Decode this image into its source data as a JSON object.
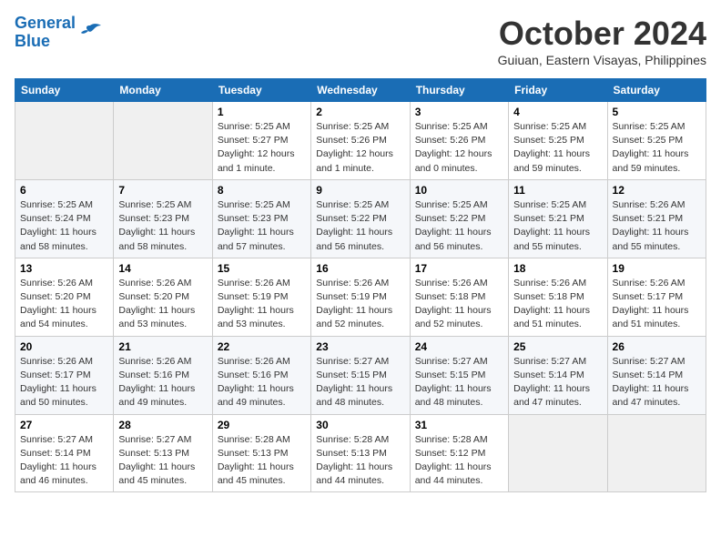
{
  "header": {
    "logo_line1": "General",
    "logo_line2": "Blue",
    "month": "October 2024",
    "location": "Guiuan, Eastern Visayas, Philippines"
  },
  "weekdays": [
    "Sunday",
    "Monday",
    "Tuesday",
    "Wednesday",
    "Thursday",
    "Friday",
    "Saturday"
  ],
  "weeks": [
    [
      {
        "day": "",
        "info": ""
      },
      {
        "day": "",
        "info": ""
      },
      {
        "day": "1",
        "info": "Sunrise: 5:25 AM\nSunset: 5:27 PM\nDaylight: 12 hours\nand 1 minute."
      },
      {
        "day": "2",
        "info": "Sunrise: 5:25 AM\nSunset: 5:26 PM\nDaylight: 12 hours\nand 1 minute."
      },
      {
        "day": "3",
        "info": "Sunrise: 5:25 AM\nSunset: 5:26 PM\nDaylight: 12 hours\nand 0 minutes."
      },
      {
        "day": "4",
        "info": "Sunrise: 5:25 AM\nSunset: 5:25 PM\nDaylight: 11 hours\nand 59 minutes."
      },
      {
        "day": "5",
        "info": "Sunrise: 5:25 AM\nSunset: 5:25 PM\nDaylight: 11 hours\nand 59 minutes."
      }
    ],
    [
      {
        "day": "6",
        "info": "Sunrise: 5:25 AM\nSunset: 5:24 PM\nDaylight: 11 hours\nand 58 minutes."
      },
      {
        "day": "7",
        "info": "Sunrise: 5:25 AM\nSunset: 5:23 PM\nDaylight: 11 hours\nand 58 minutes."
      },
      {
        "day": "8",
        "info": "Sunrise: 5:25 AM\nSunset: 5:23 PM\nDaylight: 11 hours\nand 57 minutes."
      },
      {
        "day": "9",
        "info": "Sunrise: 5:25 AM\nSunset: 5:22 PM\nDaylight: 11 hours\nand 56 minutes."
      },
      {
        "day": "10",
        "info": "Sunrise: 5:25 AM\nSunset: 5:22 PM\nDaylight: 11 hours\nand 56 minutes."
      },
      {
        "day": "11",
        "info": "Sunrise: 5:25 AM\nSunset: 5:21 PM\nDaylight: 11 hours\nand 55 minutes."
      },
      {
        "day": "12",
        "info": "Sunrise: 5:26 AM\nSunset: 5:21 PM\nDaylight: 11 hours\nand 55 minutes."
      }
    ],
    [
      {
        "day": "13",
        "info": "Sunrise: 5:26 AM\nSunset: 5:20 PM\nDaylight: 11 hours\nand 54 minutes."
      },
      {
        "day": "14",
        "info": "Sunrise: 5:26 AM\nSunset: 5:20 PM\nDaylight: 11 hours\nand 53 minutes."
      },
      {
        "day": "15",
        "info": "Sunrise: 5:26 AM\nSunset: 5:19 PM\nDaylight: 11 hours\nand 53 minutes."
      },
      {
        "day": "16",
        "info": "Sunrise: 5:26 AM\nSunset: 5:19 PM\nDaylight: 11 hours\nand 52 minutes."
      },
      {
        "day": "17",
        "info": "Sunrise: 5:26 AM\nSunset: 5:18 PM\nDaylight: 11 hours\nand 52 minutes."
      },
      {
        "day": "18",
        "info": "Sunrise: 5:26 AM\nSunset: 5:18 PM\nDaylight: 11 hours\nand 51 minutes."
      },
      {
        "day": "19",
        "info": "Sunrise: 5:26 AM\nSunset: 5:17 PM\nDaylight: 11 hours\nand 51 minutes."
      }
    ],
    [
      {
        "day": "20",
        "info": "Sunrise: 5:26 AM\nSunset: 5:17 PM\nDaylight: 11 hours\nand 50 minutes."
      },
      {
        "day": "21",
        "info": "Sunrise: 5:26 AM\nSunset: 5:16 PM\nDaylight: 11 hours\nand 49 minutes."
      },
      {
        "day": "22",
        "info": "Sunrise: 5:26 AM\nSunset: 5:16 PM\nDaylight: 11 hours\nand 49 minutes."
      },
      {
        "day": "23",
        "info": "Sunrise: 5:27 AM\nSunset: 5:15 PM\nDaylight: 11 hours\nand 48 minutes."
      },
      {
        "day": "24",
        "info": "Sunrise: 5:27 AM\nSunset: 5:15 PM\nDaylight: 11 hours\nand 48 minutes."
      },
      {
        "day": "25",
        "info": "Sunrise: 5:27 AM\nSunset: 5:14 PM\nDaylight: 11 hours\nand 47 minutes."
      },
      {
        "day": "26",
        "info": "Sunrise: 5:27 AM\nSunset: 5:14 PM\nDaylight: 11 hours\nand 47 minutes."
      }
    ],
    [
      {
        "day": "27",
        "info": "Sunrise: 5:27 AM\nSunset: 5:14 PM\nDaylight: 11 hours\nand 46 minutes."
      },
      {
        "day": "28",
        "info": "Sunrise: 5:27 AM\nSunset: 5:13 PM\nDaylight: 11 hours\nand 45 minutes."
      },
      {
        "day": "29",
        "info": "Sunrise: 5:28 AM\nSunset: 5:13 PM\nDaylight: 11 hours\nand 45 minutes."
      },
      {
        "day": "30",
        "info": "Sunrise: 5:28 AM\nSunset: 5:13 PM\nDaylight: 11 hours\nand 44 minutes."
      },
      {
        "day": "31",
        "info": "Sunrise: 5:28 AM\nSunset: 5:12 PM\nDaylight: 11 hours\nand 44 minutes."
      },
      {
        "day": "",
        "info": ""
      },
      {
        "day": "",
        "info": ""
      }
    ]
  ]
}
